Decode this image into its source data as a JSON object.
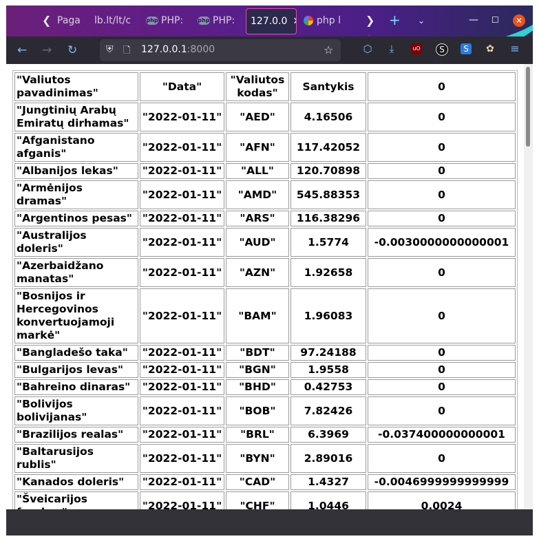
{
  "browser": {
    "tabs": [
      {
        "label": "Paga"
      },
      {
        "label": "lb.lt/lt/c"
      },
      {
        "label": "PHP:"
      },
      {
        "label": "PHP:"
      },
      {
        "label": "127.0.0"
      },
      {
        "label": "php l"
      }
    ],
    "url": {
      "host": "127.0.0.1",
      "port": ":8000"
    },
    "accent_color": "#e04fa6"
  },
  "table": {
    "headers": [
      "\"Valiutos pavadinimas\"",
      "\"Data\"",
      "\"Valiutos kodas\"",
      "Santykis",
      "0"
    ],
    "rows": [
      [
        "\"Jungtinių Arabų Emiratų dirhamas\"",
        "\"2022-01-11\"",
        "\"AED\"",
        "4.16506",
        "0"
      ],
      [
        "\"Afganistano afganis\"",
        "\"2022-01-11\"",
        "\"AFN\"",
        "117.42052",
        "0"
      ],
      [
        "\"Albanijos lekas\"",
        "\"2022-01-11\"",
        "\"ALL\"",
        "120.70898",
        "0"
      ],
      [
        "\"Armėnijos dramas\"",
        "\"2022-01-11\"",
        "\"AMD\"",
        "545.88353",
        "0"
      ],
      [
        "\"Argentinos pesas\"",
        "\"2022-01-11\"",
        "\"ARS\"",
        "116.38296",
        "0"
      ],
      [
        "\"Australijos doleris\"",
        "\"2022-01-11\"",
        "\"AUD\"",
        "1.5774",
        "-0.0030000000000001"
      ],
      [
        "\"Azerbaidžano manatas\"",
        "\"2022-01-11\"",
        "\"AZN\"",
        "1.92658",
        "0"
      ],
      [
        "\"Bosnijos ir Hercegovinos konvertuojamoji markė\"",
        "\"2022-01-11\"",
        "\"BAM\"",
        "1.96083",
        "0"
      ],
      [
        "\"Bangladešo taka\"",
        "\"2022-01-11\"",
        "\"BDT\"",
        "97.24188",
        "0"
      ],
      [
        "\"Bulgarijos levas\"",
        "\"2022-01-11\"",
        "\"BGN\"",
        "1.9558",
        "0"
      ],
      [
        "\"Bahreino dinaras\"",
        "\"2022-01-11\"",
        "\"BHD\"",
        "0.42753",
        "0"
      ],
      [
        "\"Bolivijos bolivijanas\"",
        "\"2022-01-11\"",
        "\"BOB\"",
        "7.82426",
        "0"
      ],
      [
        "\"Brazilijos realas\"",
        "\"2022-01-11\"",
        "\"BRL\"",
        "6.3969",
        "-0.037400000000001"
      ],
      [
        "\"Baltarusijos rublis\"",
        "\"2022-01-11\"",
        "\"BYN\"",
        "2.89016",
        "0"
      ],
      [
        "\"Kanados doleris\"",
        "\"2022-01-11\"",
        "\"CAD\"",
        "1.4327",
        "-0.0046999999999999"
      ],
      [
        "\"Šveicarijos frankas\"",
        "\"2022-01-11\"",
        "\"CHF\"",
        "1.0446",
        "0.0024"
      ]
    ]
  }
}
